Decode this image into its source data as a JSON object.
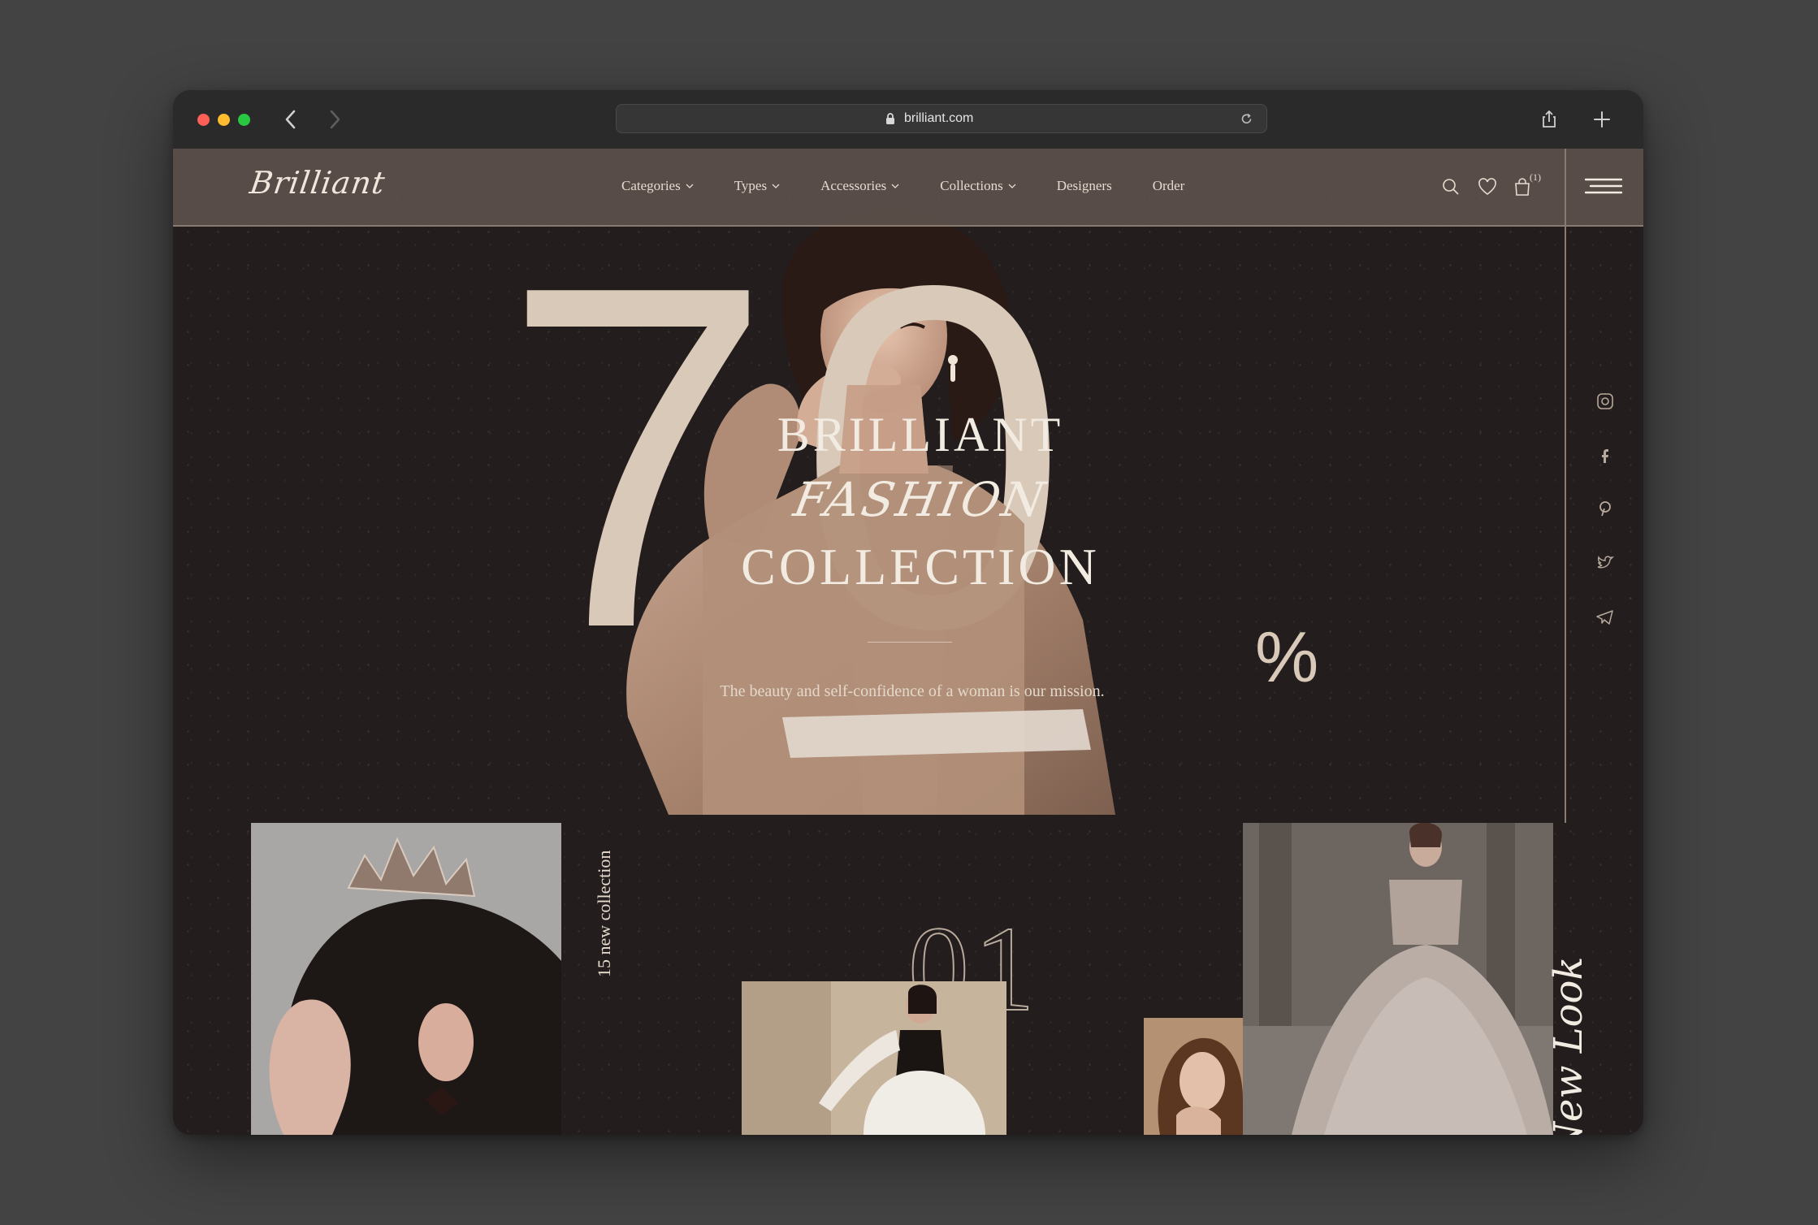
{
  "browser": {
    "url": "brilliant.com"
  },
  "site": {
    "logo": "Brilliant",
    "nav": [
      {
        "label": "Categories",
        "dropdown": true
      },
      {
        "label": "Types",
        "dropdown": true
      },
      {
        "label": "Accessories",
        "dropdown": true
      },
      {
        "label": "Collections",
        "dropdown": true
      },
      {
        "label": "Designers",
        "dropdown": false
      },
      {
        "label": "Order",
        "dropdown": false
      }
    ],
    "cart_count": "(1)"
  },
  "hero": {
    "big_number": "70",
    "percent": "%",
    "title_line1": "BRILLIANT",
    "title_line2": "FASHION",
    "title_line3": "COLLECTION",
    "tagline": "The beauty and self-confidence of a woman is our mission."
  },
  "gallery": {
    "vertical_label": "15 new collection",
    "number": "01",
    "script_text": "New Look"
  },
  "social_icons": [
    "instagram-icon",
    "facebook-icon",
    "pinterest-icon",
    "twitter-icon",
    "telegram-icon"
  ],
  "colors": {
    "accent": "#d9c9b8",
    "background": "#231e1d",
    "header": "#5e534e"
  }
}
